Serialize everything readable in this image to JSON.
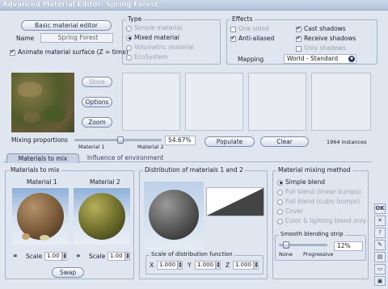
{
  "window": {
    "title": "Advanced Material Editor: Spring Forest"
  },
  "header": {
    "basic_editor_label": "Basic material editor",
    "name_label": "Name",
    "name_value": "Spring Forest",
    "animate_label": "Animate material surface (Z = time)"
  },
  "type_group": {
    "title": "Type",
    "options": [
      "Simple material",
      "Mixed material",
      "Volumetric material",
      "EcoSystem"
    ]
  },
  "effects_group": {
    "title": "Effects",
    "one_sided": "One sided",
    "anti_aliased": "Anti-aliased",
    "cast_shadows": "Cast shadows",
    "receive_shadows": "Receive shadows",
    "only_shadows": "Only shadows",
    "mapping_label": "Mapping",
    "mapping_value": "World - Standard"
  },
  "left_buttons": {
    "store": "Store",
    "options": "Options",
    "zoom": "Zoom"
  },
  "mixing": {
    "label": "Mixing proportions",
    "material1": "Material 1",
    "material2": "Material 2",
    "value": "54.67%",
    "populate": "Populate",
    "clear": "Clear",
    "instances": "1964 instances"
  },
  "tabs": {
    "active": "Materials to mix",
    "inactive": "Influence of environment"
  },
  "materials_panel": {
    "title": "Materials to mix",
    "material1": "Material 1",
    "material2": "Material 2",
    "scale_label": "Scale",
    "scale1": "1.00",
    "scale2": "1.00",
    "swap": "Swap"
  },
  "distribution_panel": {
    "title": "Distribution of materials 1 and 2",
    "scale_title": "Scale of distribution function",
    "x_label": "X",
    "x_value": "1.000",
    "y_label": "Y",
    "y_value": "1.000",
    "z_label": "Z",
    "z_value": "1.000"
  },
  "method_panel": {
    "title": "Material mixing method",
    "options": [
      "Simple blend",
      "Full blend (linear bumps)",
      "Full blend (cubic bumps)",
      "Cover",
      "Color & lighting blend only"
    ],
    "strip_title": "Smooth blending strip",
    "strip_value": "12%",
    "strip_none": "None",
    "strip_progressive": "Progressive"
  },
  "side": {
    "ok": "OK",
    "cancel": "✕",
    "help": "?"
  },
  "colors": {
    "background": "#dfe6f0",
    "title_bar": "#b5c3da",
    "accent": "#1c2a4d"
  }
}
